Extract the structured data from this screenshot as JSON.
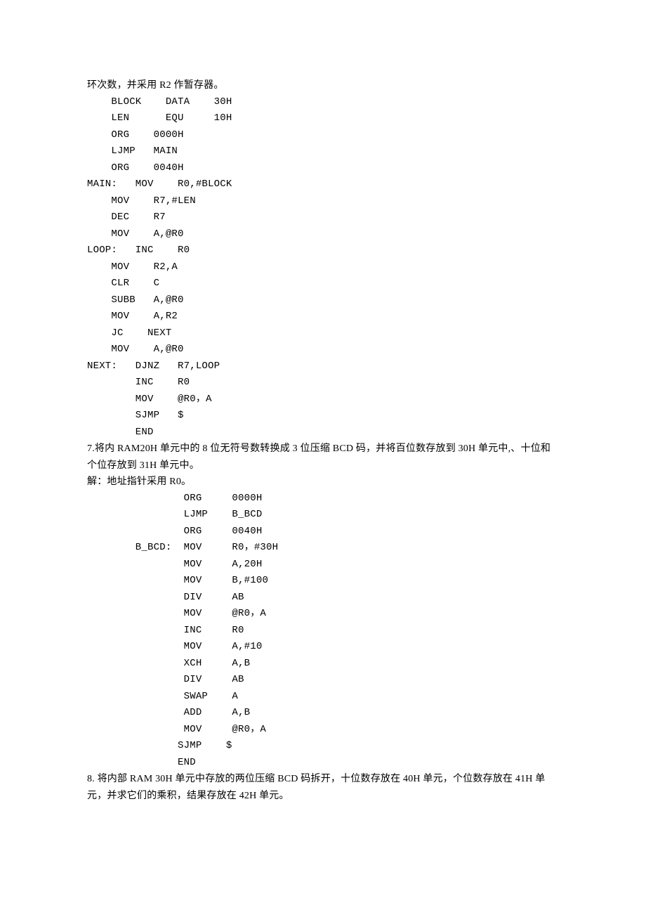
{
  "lines": [
    {
      "cls": "text-line",
      "txt": "环次数，并采用 R2 作暂存器。"
    },
    {
      "cls": "code-line",
      "txt": "    BLOCK    DATA    30H"
    },
    {
      "cls": "code-line",
      "txt": "    LEN      EQU     10H"
    },
    {
      "cls": "code-line",
      "txt": "    ORG    0000H"
    },
    {
      "cls": "code-line",
      "txt": "    LJMP   MAIN"
    },
    {
      "cls": "code-line",
      "txt": "    ORG    0040H"
    },
    {
      "cls": "code-line",
      "txt": "MAIN:   MOV    R0,#BLOCK"
    },
    {
      "cls": "code-line",
      "txt": "    MOV    R7,#LEN"
    },
    {
      "cls": "code-line",
      "txt": "    DEC    R7"
    },
    {
      "cls": "code-line",
      "txt": "    MOV    A,@R0"
    },
    {
      "cls": "code-line",
      "txt": "LOOP:   INC    R0"
    },
    {
      "cls": "code-line",
      "txt": "    MOV    R2,A"
    },
    {
      "cls": "code-line",
      "txt": "    CLR    C"
    },
    {
      "cls": "code-line",
      "txt": "    SUBB   A,@R0"
    },
    {
      "cls": "code-line",
      "txt": "    MOV    A,R2"
    },
    {
      "cls": "code-line",
      "txt": "    JC    NEXT"
    },
    {
      "cls": "code-line",
      "txt": "    MOV    A,@R0"
    },
    {
      "cls": "code-line",
      "txt": "NEXT:   DJNZ   R7,LOOP"
    },
    {
      "cls": "code-line",
      "txt": "        INC    R0"
    },
    {
      "cls": "code-line",
      "txt": "        MOV    @R0，A"
    },
    {
      "cls": "code-line",
      "txt": "        SJMP   $"
    },
    {
      "cls": "code-line",
      "txt": "        END"
    },
    {
      "cls": "text-line",
      "txt": "7.将内 RAM20H 单元中的 8 位无符号数转换成 3 位压缩 BCD 码，并将百位数存放到 30H 单元中,、十位和个位存放到 31H 单元中。"
    },
    {
      "cls": "text-line",
      "txt": "解：地址指针采用 R0。"
    },
    {
      "cls": "code-line",
      "txt": "                ORG     0000H"
    },
    {
      "cls": "code-line",
      "txt": "                LJMP    B_BCD"
    },
    {
      "cls": "code-line",
      "txt": "                ORG     0040H"
    },
    {
      "cls": "code-line",
      "txt": "        B_BCD:  MOV     R0，#30H"
    },
    {
      "cls": "code-line",
      "txt": "                MOV     A,20H"
    },
    {
      "cls": "code-line",
      "txt": "                MOV     B,#100"
    },
    {
      "cls": "code-line",
      "txt": "                DIV     AB"
    },
    {
      "cls": "code-line",
      "txt": "                MOV     @R0，A"
    },
    {
      "cls": "code-line",
      "txt": "                INC     R0"
    },
    {
      "cls": "code-line",
      "txt": "                MOV     A,#10"
    },
    {
      "cls": "code-line",
      "txt": "                XCH     A,B"
    },
    {
      "cls": "code-line",
      "txt": "                DIV     AB"
    },
    {
      "cls": "code-line",
      "txt": "                SWAP    A"
    },
    {
      "cls": "code-line",
      "txt": "                ADD     A,B"
    },
    {
      "cls": "code-line",
      "txt": "                MOV     @R0，A"
    },
    {
      "cls": "code-line",
      "txt": "               SJMP    $"
    },
    {
      "cls": "code-line",
      "txt": "               END"
    },
    {
      "cls": "text-line",
      "txt": "8. 将内部 RAM 30H 单元中存放的两位压缩 BCD 码拆开，十位数存放在 40H 单元，个位数存放在 41H 单元，并求它们的乘积，结果存放在 42H 单元。"
    }
  ]
}
